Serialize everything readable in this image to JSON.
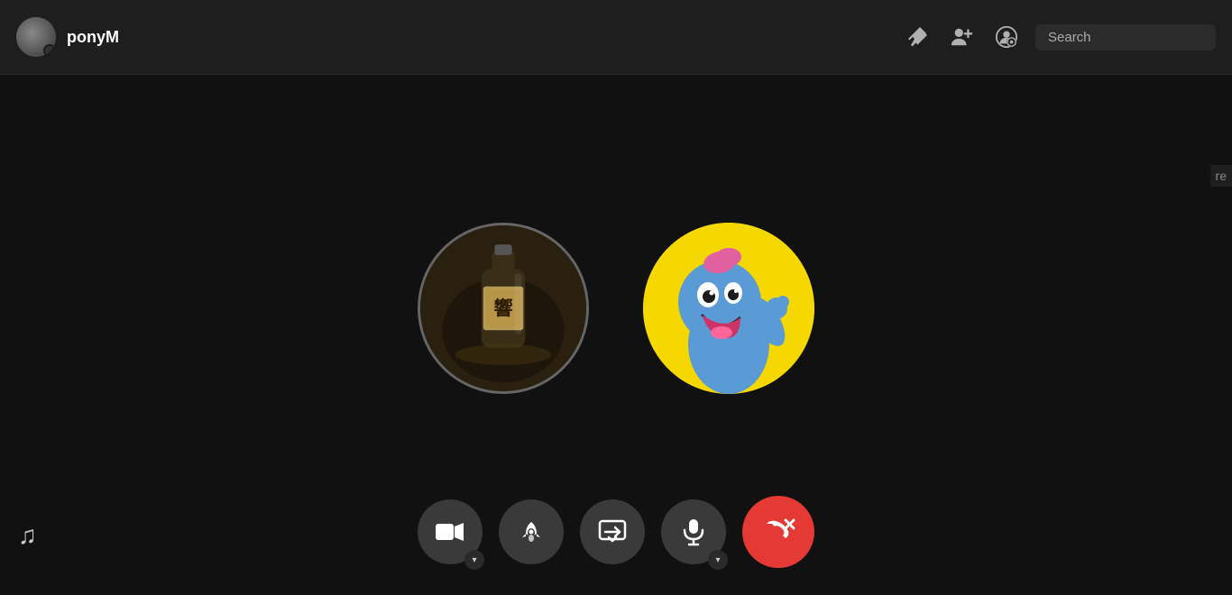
{
  "topbar": {
    "channel_name": "ponyM",
    "search_placeholder": "Search"
  },
  "controls": {
    "video_label": "Video",
    "boost_label": "Boost",
    "share_label": "Share Screen",
    "mute_label": "Mute",
    "end_call_label": "End Call"
  },
  "partial_right_text": "re",
  "music_icon": "♫"
}
